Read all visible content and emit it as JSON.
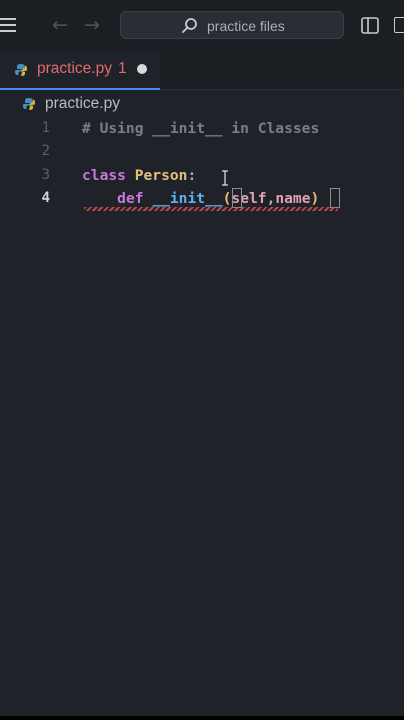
{
  "titlebar": {
    "search_placeholder": "practice files",
    "back_icon": "arrow-left-icon",
    "forward_icon": "arrow-right-icon"
  },
  "tab": {
    "label": "practice.py",
    "problem_count": "1",
    "label_color": "#e06c6c",
    "accent": "#4a8cf0"
  },
  "breadcrumb": {
    "file": "practice.py"
  },
  "editor": {
    "lines": [
      {
        "number": "1",
        "text": "# Using __init__ in Classes"
      },
      {
        "number": "2",
        "text": ""
      },
      {
        "number": "3",
        "text": "class Person:"
      },
      {
        "number": "4",
        "text": "    def __init__(self,name)"
      }
    ],
    "active_line": "4",
    "tokens": {
      "comment": "# Using __init__ in Classes",
      "class_kw": "class",
      "class_name": "Person",
      "colon": ":",
      "indent": "    ",
      "def_kw": "def",
      "fn_name": "__init__",
      "open_paren": "(",
      "param_self": "self",
      "comma": ",",
      "param_name": "name",
      "close_paren": ")"
    }
  }
}
